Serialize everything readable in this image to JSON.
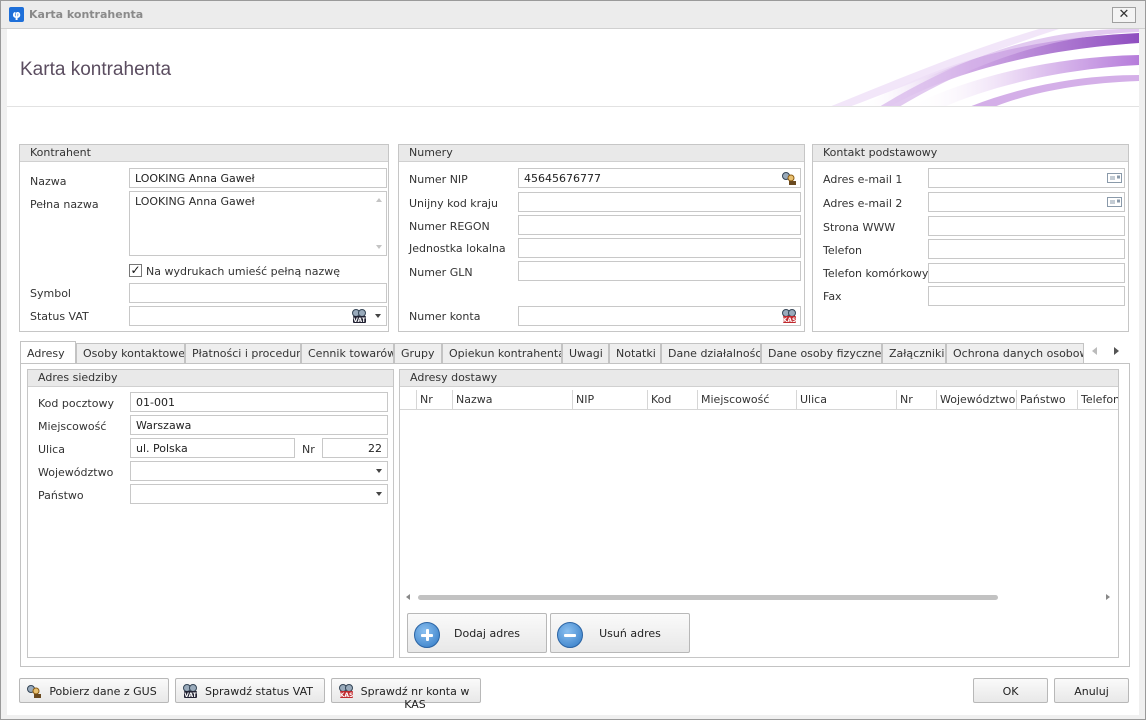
{
  "window": {
    "title": "Karta kontrahenta",
    "close_glyph": "✕"
  },
  "header": {
    "title": "Karta kontrahenta"
  },
  "kontrahent": {
    "title": "Kontrahent",
    "nazwa_label": "Nazwa",
    "nazwa_value": "LOOKING Anna Gaweł",
    "pelna_nazwa_label": "Pełna nazwa",
    "pelna_nazwa_value": "LOOKING Anna Gaweł",
    "checkbox_label": "Na wydrukach umieść pełną nazwę",
    "checkbox_checked": true,
    "symbol_label": "Symbol",
    "symbol_value": "",
    "status_vat_label": "Status VAT",
    "status_vat_value": ""
  },
  "numery": {
    "title": "Numery",
    "nip_label": "Numer NIP",
    "nip_value": "45645676777",
    "unijny_label": "Unijny kod kraju",
    "unijny_value": "",
    "regon_label": "Numer REGON",
    "regon_value": "",
    "jednostka_label": "Jednostka lokalna",
    "jednostka_value": "",
    "gln_label": "Numer GLN",
    "gln_value": "",
    "konto_label": "Numer konta",
    "konto_value": ""
  },
  "kontakt": {
    "title": "Kontakt podstawowy",
    "email1_label": "Adres e-mail 1",
    "email1_value": "",
    "email2_label": "Adres e-mail 2",
    "email2_value": "",
    "www_label": "Strona WWW",
    "www_value": "",
    "telefon_label": "Telefon",
    "telefon_value": "",
    "komorkowy_label": "Telefon komórkowy",
    "komorkowy_value": "",
    "fax_label": "Fax",
    "fax_value": ""
  },
  "tabs": [
    {
      "label": "Adresy",
      "active": true
    },
    {
      "label": "Osoby kontaktowe"
    },
    {
      "label": "Płatności i procedury"
    },
    {
      "label": "Cennik towarów"
    },
    {
      "label": "Grupy"
    },
    {
      "label": "Opiekun kontrahenta"
    },
    {
      "label": "Uwagi"
    },
    {
      "label": "Notatki"
    },
    {
      "label": "Dane działalności"
    },
    {
      "label": "Dane osoby fizycznej"
    },
    {
      "label": "Załączniki"
    },
    {
      "label": "Ochrona danych osobowych"
    }
  ],
  "adres_siedziby": {
    "title": "Adres siedziby",
    "kod_label": "Kod pocztowy",
    "kod_value": "01-001",
    "miejscowosc_label": "Miejscowość",
    "miejscowosc_value": "Warszawa",
    "ulica_label": "Ulica",
    "ulica_value": "ul. Polska",
    "nr_label": "Nr",
    "nr_value": "22",
    "wojewodztwo_label": "Województwo",
    "wojewodztwo_value": "",
    "panstwo_label": "Państwo",
    "panstwo_value": ""
  },
  "adresy_dostawy": {
    "title": "Adresy dostawy",
    "columns": [
      "Nr",
      "Nazwa",
      "NIP",
      "Kod",
      "Miejscowość",
      "Ulica",
      "Nr",
      "Województwo",
      "Państwo",
      "Telefon"
    ],
    "rows": [],
    "add_button": "Dodaj adres",
    "remove_button": "Usuń adres"
  },
  "footer": {
    "gus_button": "Pobierz dane z GUS",
    "vat_button": "Sprawdź status VAT",
    "kas_button": "Sprawdź nr konta w KAS",
    "ok_button": "OK",
    "cancel_button": "Anuluj"
  },
  "colors": {
    "accent_purple": "#8b3fc0",
    "banner_title": "#5b4d60",
    "kas_red": "#c0282d"
  }
}
